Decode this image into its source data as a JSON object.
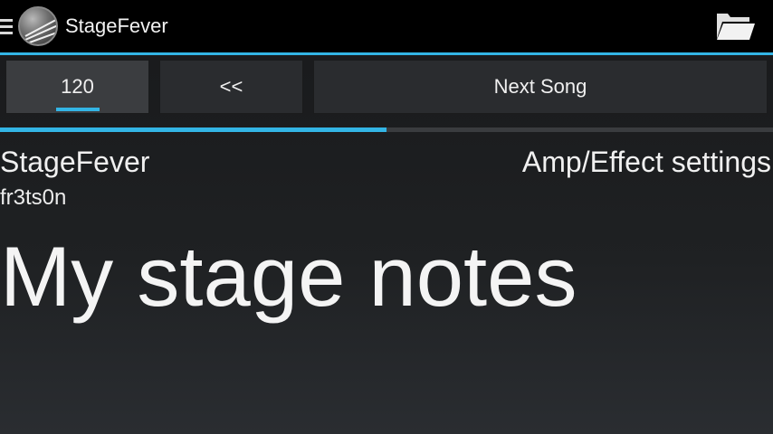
{
  "action_bar": {
    "title": "StageFever",
    "icons": [
      "drawer-icon",
      "app-logo-icon",
      "folder-open-icon"
    ]
  },
  "controls": {
    "bpm_label": "120",
    "back_label": "<<",
    "next_label": "Next Song"
  },
  "progress": {
    "fraction": 0.5
  },
  "song": {
    "title": "StageFever",
    "artist": "fr3ts0n",
    "amp_settings_label": "Amp/Effect settings",
    "notes": "My stage notes"
  },
  "colors": {
    "accent": "#33b5e5",
    "action_bar_bg": "#000000",
    "background": "#1d1f21",
    "button_bg": "#2a2c2f"
  }
}
